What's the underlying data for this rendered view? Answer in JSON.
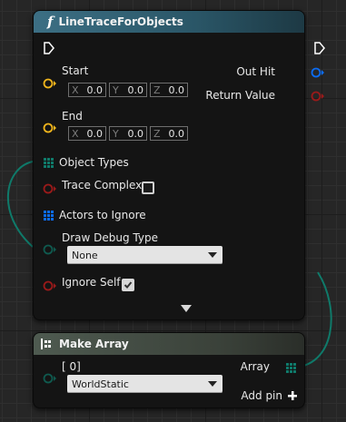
{
  "node_trace": {
    "title": "LineTraceForObjects",
    "pins": {
      "start_label": "Start",
      "end_label": "End",
      "out_hit_label": "Out Hit",
      "return_value_label": "Return Value",
      "object_types_label": "Object Types",
      "trace_complex_label": "Trace Complex",
      "actors_to_ignore_label": "Actors to Ignore",
      "draw_debug_type_label": "Draw Debug Type",
      "ignore_self_label": "Ignore Self"
    },
    "start": {
      "x_axis": "X",
      "x": "0.0",
      "y_axis": "Y",
      "y": "0.0",
      "z_axis": "Z",
      "z": "0.0"
    },
    "end": {
      "x_axis": "X",
      "x": "0.0",
      "y_axis": "Y",
      "y": "0.0",
      "z_axis": "Z",
      "z": "0.0"
    },
    "draw_debug_type_value": "None",
    "trace_complex_checked": false,
    "ignore_self_checked": true
  },
  "node_make_array": {
    "title": "Make Array",
    "index_label": "[ 0]",
    "array_label": "Array",
    "element_value": "WorldStatic",
    "add_pin_label": "Add pin"
  },
  "colors": {
    "exec": "#ffffff",
    "vector_pin": "#f0b51c",
    "object_pin": "#0c6cf2",
    "struct_pin": "#0c6cf2",
    "bool_pin": "#9a1a1a",
    "enum_pin": "#0f5a4f",
    "wire": "#0f7a6a"
  }
}
